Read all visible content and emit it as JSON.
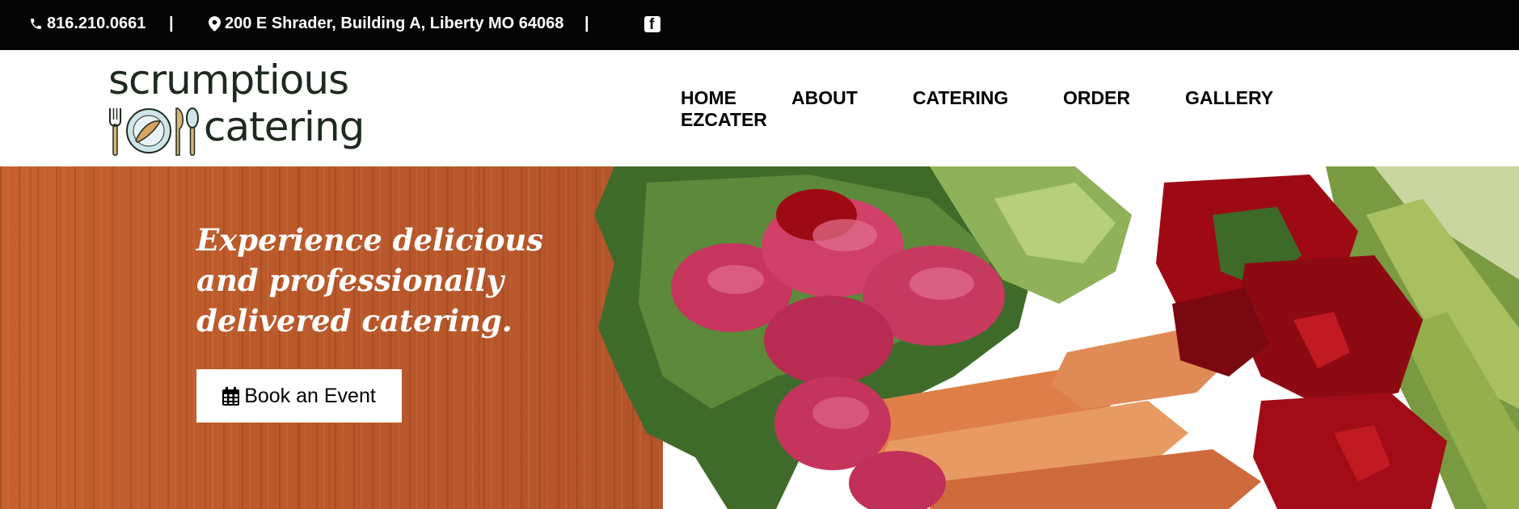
{
  "topbar": {
    "phone": "816.210.0661",
    "separator": "|",
    "address": "200 E Shrader, Building A, Liberty MO 64068",
    "facebook_icon": "facebook-icon"
  },
  "logo": {
    "line1": "scrumptious",
    "line2": "catering"
  },
  "nav": {
    "items": [
      "HOME",
      "ABOUT",
      "CATERING",
      "ORDER",
      "GALLERY",
      "EZCATER"
    ]
  },
  "hero": {
    "headline": "Experience delicious and professionally delivered catering.",
    "cta_label": "Book an Event",
    "cta_icon": "calendar-icon"
  },
  "colors": {
    "topbar_bg": "#050505",
    "wood": "#bb5a2b",
    "radish": "#c8355f",
    "pepper": "#9d0a14",
    "lettuce": "#3f6b2a"
  }
}
